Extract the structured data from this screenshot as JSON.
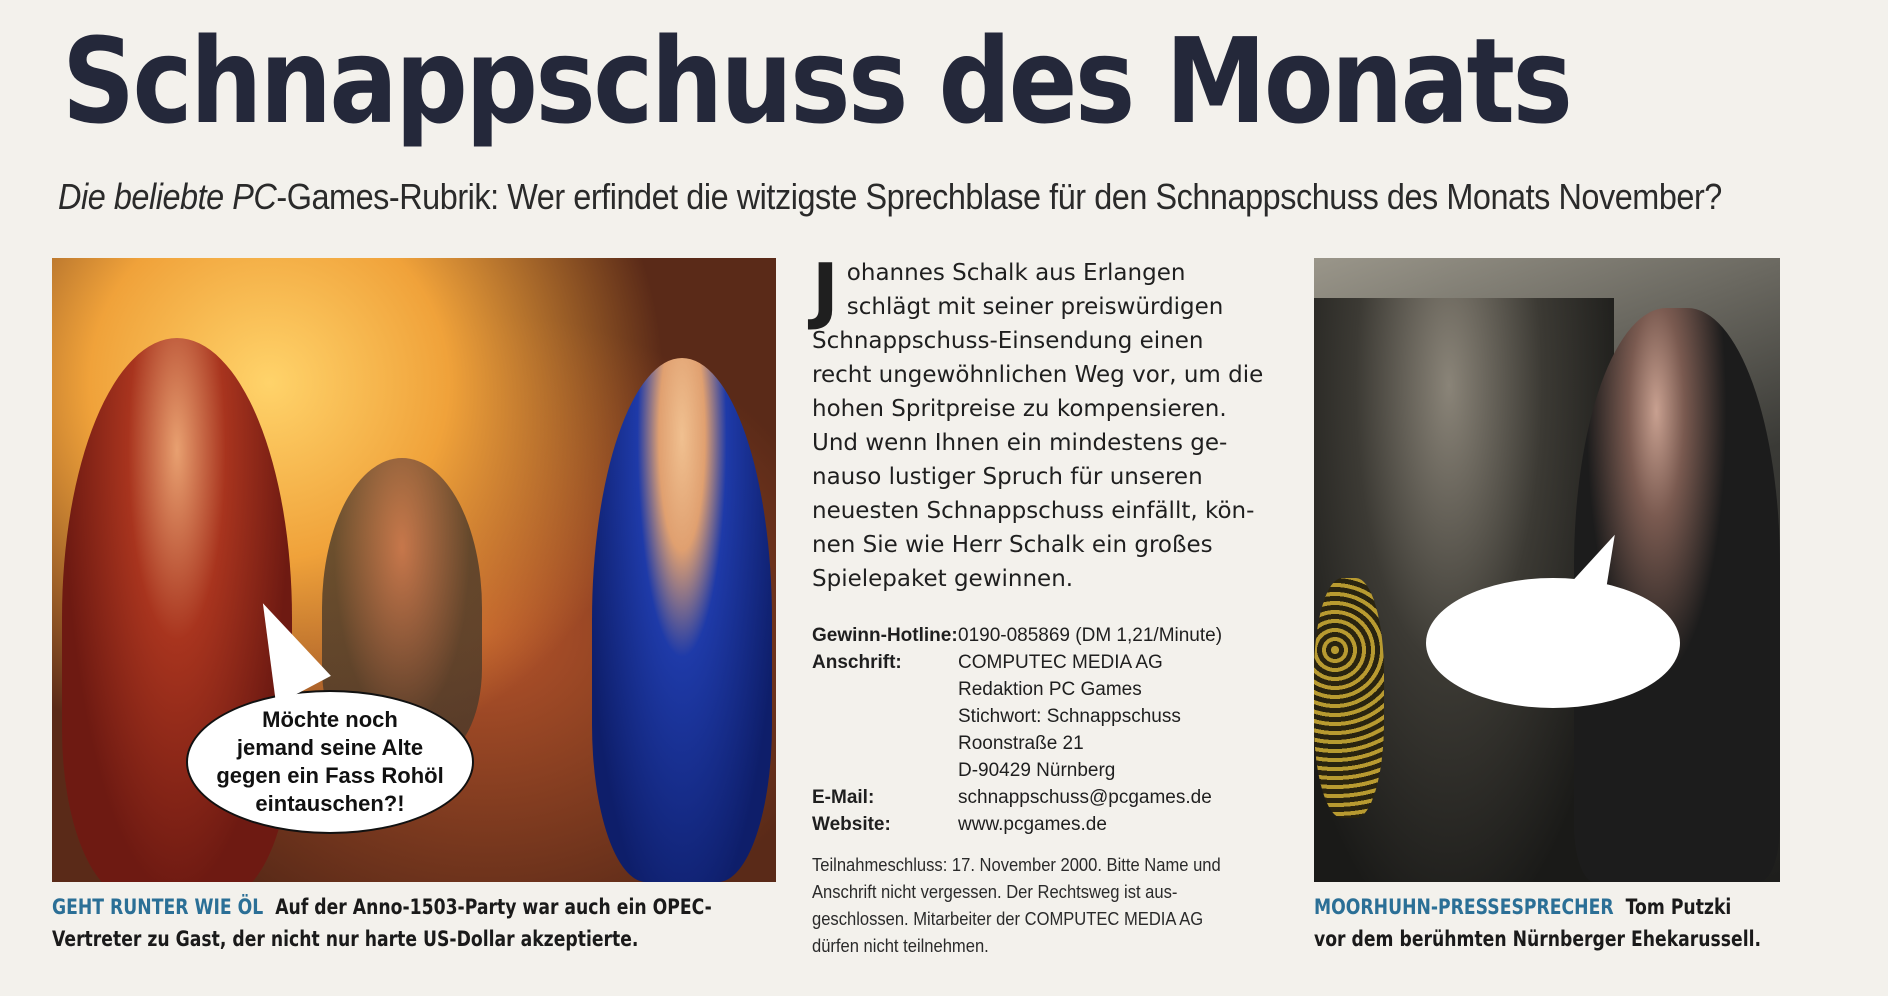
{
  "header": {
    "title": "Schnappschuss des Monats",
    "subtitle_italic": "Die beliebte PC",
    "subtitle_rest": "-Games-Rubrik: Wer erfindet die witzigste Sprechblase für den Schnappschuss des Monats November?"
  },
  "left_photo": {
    "bubble_text": "Möchte noch\njemand seine Alte\ngegen ein Fass Rohöl\neintauschen?!",
    "caption_kicker": "GEHT RUNTER WIE ÖL",
    "caption_line1": "Auf der Anno-1503-Party war auch ein OPEC-",
    "caption_line2": "Vertreter zu Gast, der nicht nur harte US-Dollar akzeptierte."
  },
  "article": {
    "dropcap": "J",
    "text": "ohannes Schalk aus Erlangen\nschlägt mit seiner preiswürdigen\nSchnappschuss-Einsendung einen\nrecht ungewöhnlichen Weg vor, um die\nhohen Spritpreise zu kompensieren.\nUnd wenn Ihnen ein mindestens ge-\nnauso lustiger Spruch für unseren\nneuesten Schnappschuss einfällt, kön-\nnen Sie wie Herr Schalk ein großes\nSpielepaket gewinnen."
  },
  "info": {
    "hotline_label": "Gewinn-Hotline:",
    "hotline_value": "0190-085869 (DM 1,21/Minute)",
    "address_label": "Anschrift:",
    "address_value": "COMPUTEC MEDIA AG\nRedaktion PC Games\nStichwort: Schnappschuss\nRoonstraße 21\nD-90429 Nürnberg",
    "email_label": "E-Mail:",
    "email_value": "schnappschuss@pcgames.de",
    "website_label": "Website:",
    "website_value": "www.pcgames.de",
    "fineprint": "Teilnahmeschluss: 17. November 2000. Bitte Name und\nAnschrift nicht vergessen. Der Rechtsweg ist aus-\ngeschlossen. Mitarbeiter der COMPUTEC MEDIA AG\ndürfen nicht teilnehmen."
  },
  "right_photo": {
    "caption_kicker": "MOORHUHN-PRESSESPRECHER",
    "caption_line1": "Tom Putzki",
    "caption_line2": "vor dem berühmten Nürnberger Ehekarussell."
  }
}
